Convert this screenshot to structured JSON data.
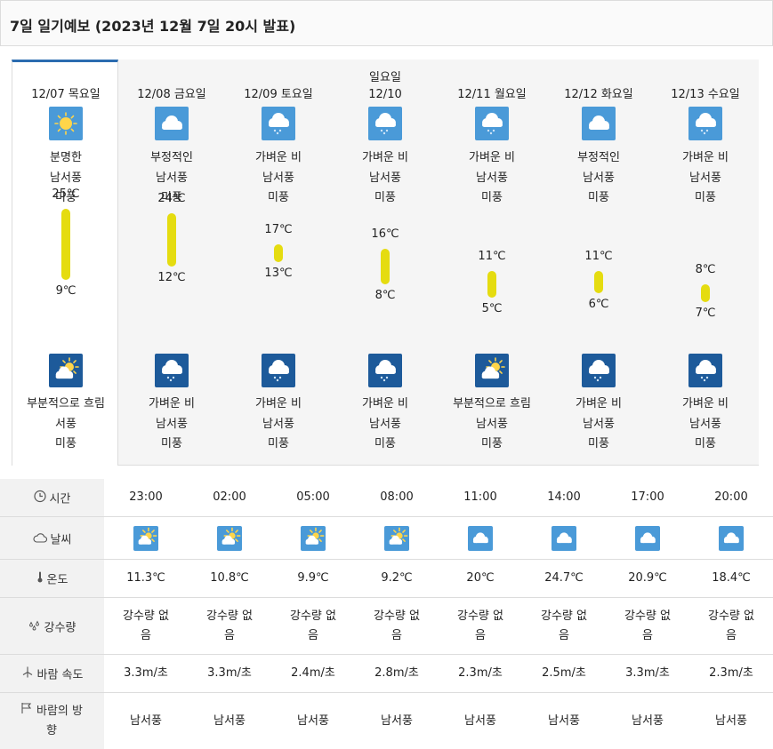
{
  "header": {
    "title": "7일 일기예보 (2023년 12월 7일 20시 발표)"
  },
  "days": [
    {
      "date": "12/07 목요일",
      "day_icon": "sunny-icon",
      "day_desc": "분명한",
      "day_wind_dir": "남서풍",
      "day_wind": "미풍",
      "high": "25℃",
      "low": "9℃",
      "night_icon": "partly-cloudy-night-icon",
      "night_desc": "부분적으로 흐림",
      "night_wind_dir": "서풍",
      "night_wind": "미풍"
    },
    {
      "date": "12/08 금요일",
      "day_icon": "cloudy-icon",
      "day_desc": "부정적인",
      "day_wind_dir": "남서풍",
      "day_wind": "미풍",
      "high": "24℃",
      "low": "12℃",
      "night_icon": "light-rain-night-icon",
      "night_desc": "가벼운 비",
      "night_wind_dir": "남서풍",
      "night_wind": "미풍"
    },
    {
      "date": "12/09 토요일",
      "day_icon": "light-rain-icon",
      "day_desc": "가벼운 비",
      "day_wind_dir": "남서풍",
      "day_wind": "미풍",
      "high": "17℃",
      "low": "13℃",
      "night_icon": "light-rain-night-icon",
      "night_desc": "가벼운 비",
      "night_wind_dir": "남서풍",
      "night_wind": "미풍"
    },
    {
      "date_line1": "일요일",
      "date": "12/10",
      "day_icon": "light-rain-icon",
      "day_desc": "가벼운 비",
      "day_wind_dir": "남서풍",
      "day_wind": "미풍",
      "high": "16℃",
      "low": "8℃",
      "night_icon": "light-rain-night-icon",
      "night_desc": "가벼운 비",
      "night_wind_dir": "남서풍",
      "night_wind": "미풍"
    },
    {
      "date": "12/11 월요일",
      "day_icon": "light-rain-icon",
      "day_desc": "가벼운 비",
      "day_wind_dir": "남서풍",
      "day_wind": "미풍",
      "high": "11℃",
      "low": "5℃",
      "night_icon": "partly-cloudy-night-icon",
      "night_desc": "부분적으로 흐림",
      "night_wind_dir": "남서풍",
      "night_wind": "미풍"
    },
    {
      "date": "12/12 화요일",
      "day_icon": "cloudy-icon",
      "day_desc": "부정적인",
      "day_wind_dir": "남서풍",
      "day_wind": "미풍",
      "high": "11℃",
      "low": "6℃",
      "night_icon": "light-rain-night-icon",
      "night_desc": "가벼운 비",
      "night_wind_dir": "남서풍",
      "night_wind": "미풍"
    },
    {
      "date": "12/13 수요일",
      "day_icon": "light-rain-icon",
      "day_desc": "가벼운 비",
      "day_wind_dir": "남서풍",
      "day_wind": "미풍",
      "high": "8℃",
      "low": "7℃",
      "night_icon": "light-rain-night-icon",
      "night_desc": "가벼운 비",
      "night_wind_dir": "남서풍",
      "night_wind": "미풍"
    }
  ],
  "hourly": {
    "labels": {
      "time": "시간",
      "weather": "날씨",
      "temperature": "온도",
      "precipitation": "강수량",
      "wind_speed": "바람 속도",
      "wind_direction": "바람의 방향"
    },
    "label_icons": {
      "time": "clock-icon",
      "weather": "cloud-icon",
      "temperature": "thermometer-icon",
      "precipitation": "raindrops-icon",
      "wind_speed": "wind-turbine-icon",
      "wind_direction": "flag-icon"
    },
    "times": [
      "23:00",
      "02:00",
      "05:00",
      "08:00",
      "11:00",
      "14:00",
      "17:00",
      "20:00"
    ],
    "weather_icons": [
      "partly-cloudy-icon",
      "partly-cloudy-icon",
      "partly-cloudy-icon",
      "partly-cloudy-icon",
      "cloudy-icon",
      "cloudy-icon",
      "cloudy-icon",
      "cloudy-icon"
    ],
    "temperatures": [
      "11.3℃",
      "10.8℃",
      "9.9℃",
      "9.2℃",
      "20℃",
      "24.7℃",
      "20.9℃",
      "18.4℃"
    ],
    "precipitation": [
      "강수량 없음",
      "강수량 없음",
      "강수량 없음",
      "강수량 없음",
      "강수량 없음",
      "강수량 없음",
      "강수량 없음",
      "강수량 없음"
    ],
    "wind_speeds": [
      "3.3m/초",
      "3.3m/초",
      "2.4m/초",
      "2.8m/초",
      "2.3m/초",
      "2.5m/초",
      "3.3m/초",
      "2.3m/초"
    ],
    "wind_directions": [
      "남서풍",
      "남서풍",
      "남서풍",
      "남서풍",
      "남서풍",
      "남서풍",
      "남서풍",
      "남서풍"
    ]
  },
  "colors": {
    "accent": "#2b6cb0",
    "temp_bar": "#e5dc10",
    "icon_day": "#4a9ad8",
    "icon_night": "#1d5a9a"
  }
}
